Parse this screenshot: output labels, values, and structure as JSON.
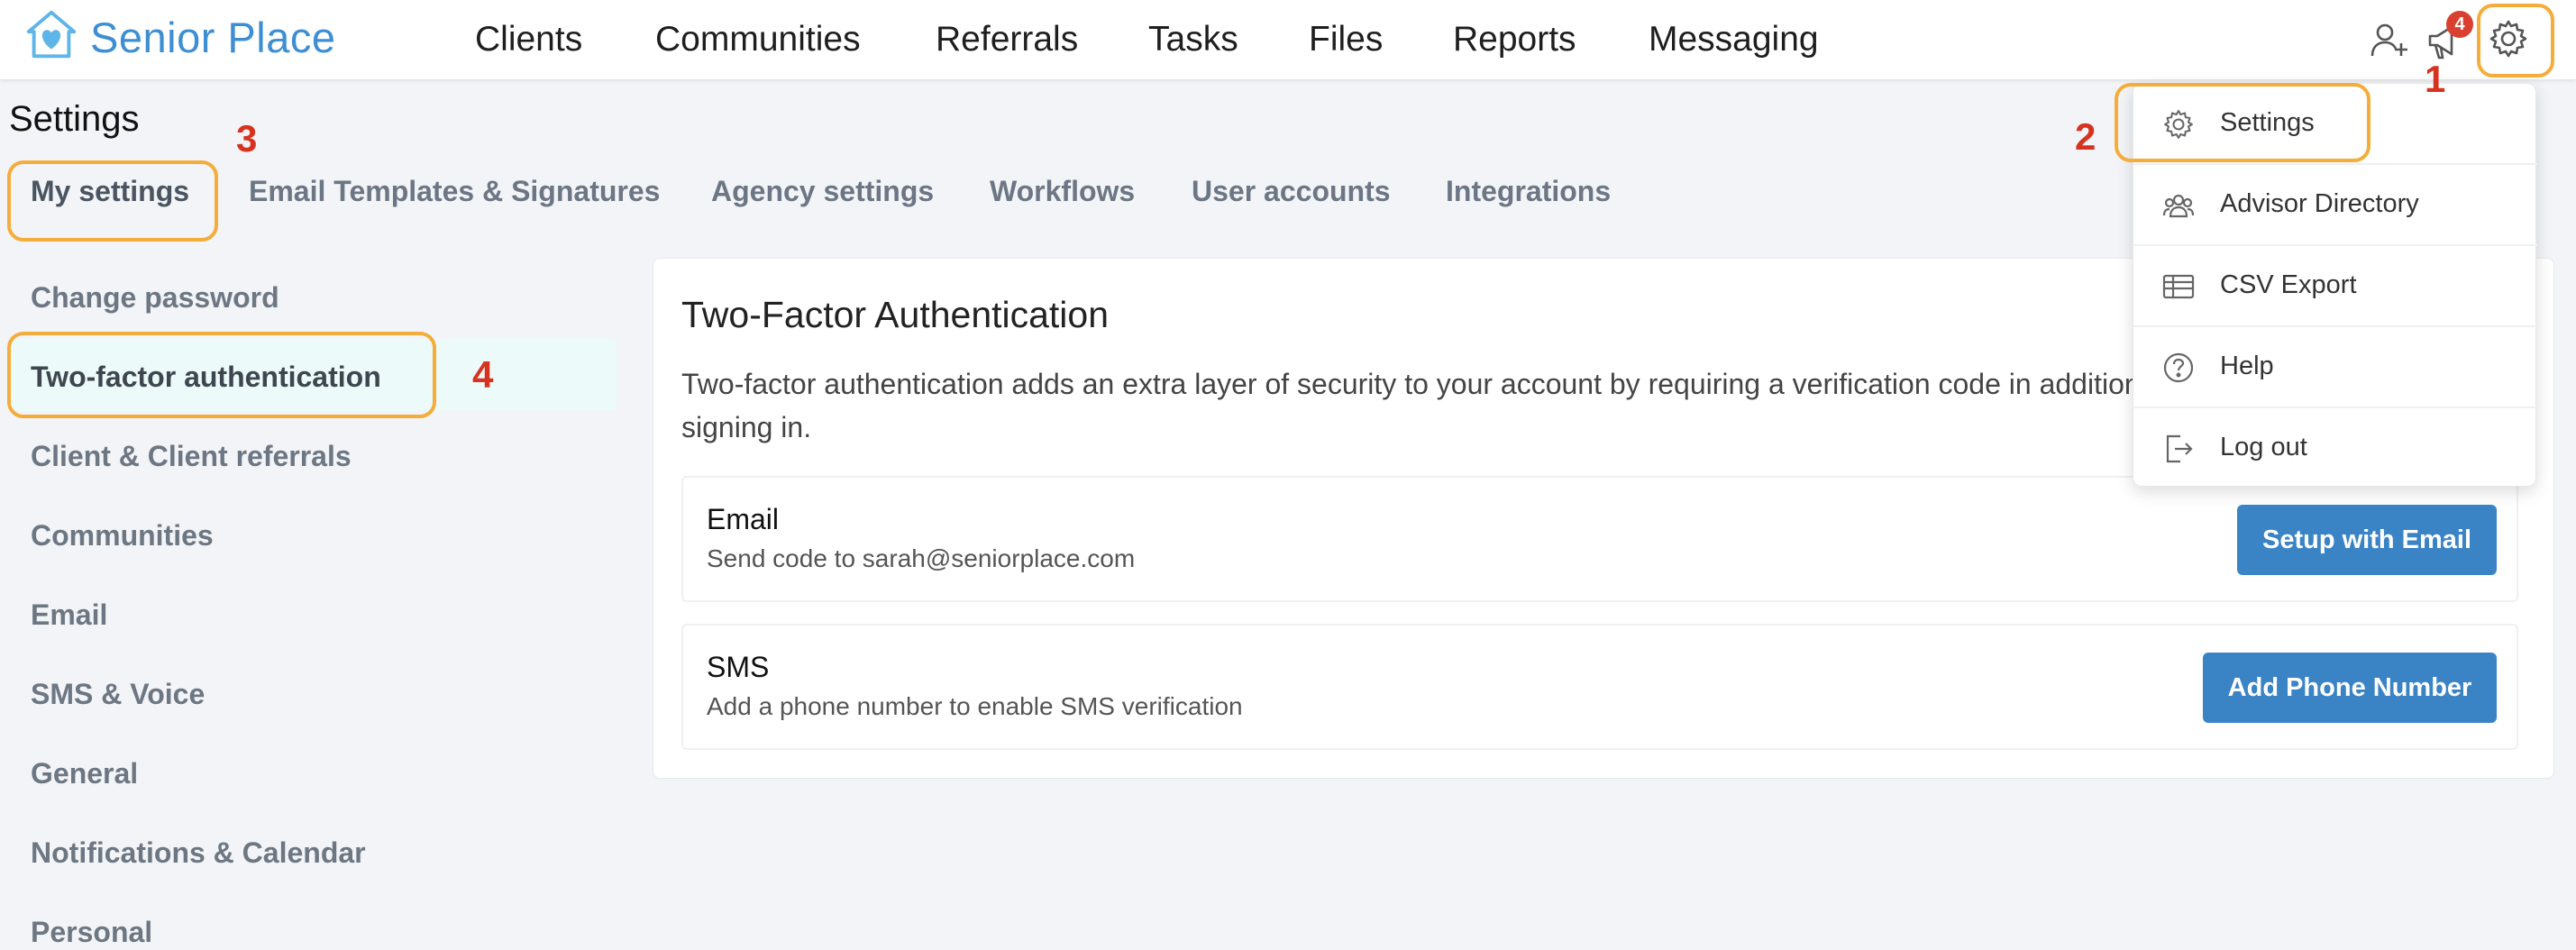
{
  "app": {
    "name": "Senior Place"
  },
  "nav": {
    "items": [
      "Clients",
      "Communities",
      "Referrals",
      "Tasks",
      "Files",
      "Reports",
      "Messaging"
    ]
  },
  "header_icons": {
    "add_user": "add-user-icon",
    "announcements": "megaphone-icon",
    "notification_count": "4",
    "settings": "gear-icon"
  },
  "page": {
    "title": "Settings"
  },
  "tabs": [
    "My settings",
    "Email Templates & Signatures",
    "Agency settings",
    "Workflows",
    "User accounts",
    "Integrations"
  ],
  "side_menu": [
    "Change password",
    "Two-factor authentication",
    "Client & Client referrals",
    "Communities",
    "Email",
    "SMS & Voice",
    "General",
    "Notifications & Calendar",
    "Personal"
  ],
  "two_factor": {
    "title": "Two-Factor Authentication",
    "description": "Two-factor authentication adds an extra layer of security to your account by requiring a verification code in addition to your password when signing in.",
    "methods": [
      {
        "name": "Email",
        "detail": "Send code to sarah@seniorplace.com",
        "button": "Setup with Email"
      },
      {
        "name": "SMS",
        "detail": "Add a phone number to enable SMS verification",
        "button": "Add Phone Number"
      }
    ]
  },
  "dropdown": {
    "items": [
      {
        "label": "Settings",
        "icon": "gear-icon"
      },
      {
        "label": "Advisor Directory",
        "icon": "people-icon"
      },
      {
        "label": "CSV Export",
        "icon": "table-icon"
      },
      {
        "label": "Help",
        "icon": "help-icon"
      },
      {
        "label": "Log out",
        "icon": "logout-icon"
      }
    ]
  },
  "annotations": [
    "1",
    "2",
    "3",
    "4"
  ],
  "colors": {
    "brand": "#3d8ed3",
    "button": "#3a84c6",
    "highlight": "#f4ad3a",
    "annotation": "#d7321f"
  }
}
